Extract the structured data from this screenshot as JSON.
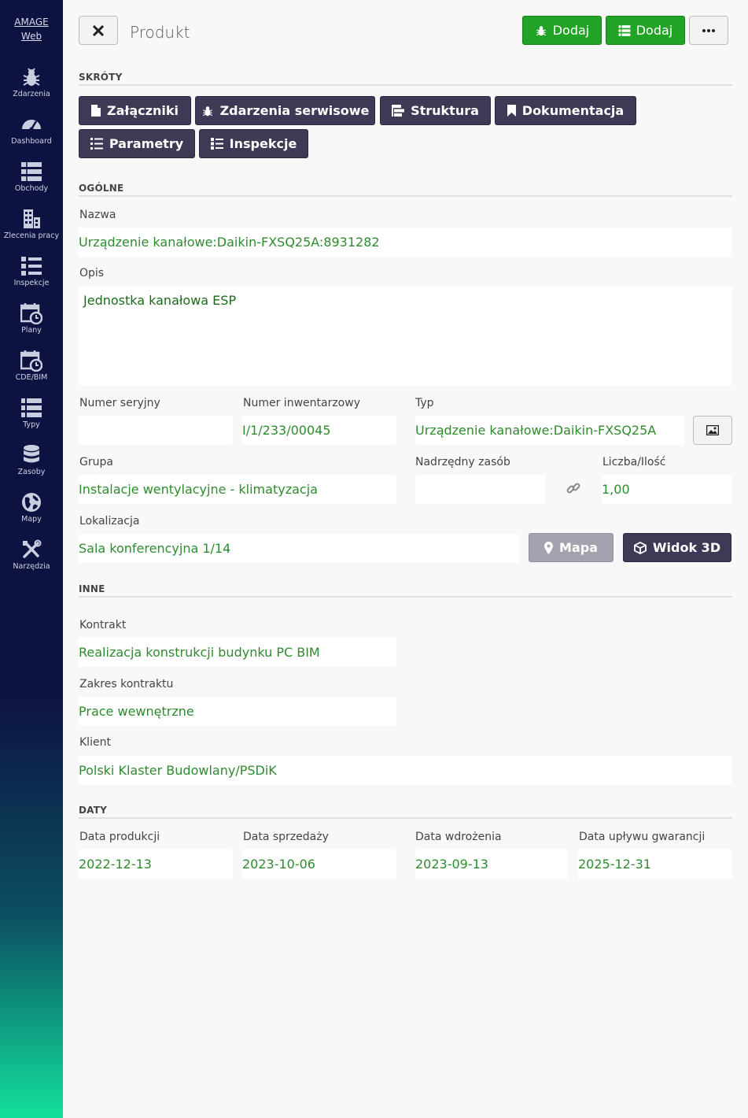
{
  "brand": {
    "line1": "AMAGE",
    "line2": "Web"
  },
  "sidebar": {
    "items": [
      {
        "label": "Zdarzenia",
        "icon": "bug-icon"
      },
      {
        "label": "Dashboard",
        "icon": "gauge-icon"
      },
      {
        "label": "Obchody",
        "icon": "list-icon"
      },
      {
        "label": "Zlecenia pracy",
        "icon": "building-icon"
      },
      {
        "label": "Inspekcje",
        "icon": "checklist-icon"
      },
      {
        "label": "Plany",
        "icon": "calendar-clock-icon"
      },
      {
        "label": "CDE/BIM",
        "icon": "calendar-clock-icon"
      },
      {
        "label": "Typy",
        "icon": "list-icon"
      },
      {
        "label": "Zasoby",
        "icon": "database-icon"
      },
      {
        "label": "Mapy",
        "icon": "globe-icon"
      },
      {
        "label": "Narzędzia",
        "icon": "tools-icon"
      }
    ]
  },
  "header": {
    "title": "Produkt",
    "add_event_label": "Dodaj",
    "add_list_label": "Dodaj"
  },
  "sections": {
    "shortcuts": "SKRÓTY",
    "general": "OGÓLNE",
    "other": "INNE",
    "dates": "DATY"
  },
  "shortcuts": [
    {
      "label": "Załączniki",
      "icon": "file-icon"
    },
    {
      "label": "Zdarzenia serwisowe",
      "icon": "bug-icon"
    },
    {
      "label": "Struktura",
      "icon": "tree-icon"
    },
    {
      "label": "Dokumentacja",
      "icon": "bookmark-icon"
    },
    {
      "label": "Parametry",
      "icon": "list-icon"
    },
    {
      "label": "Inspekcje",
      "icon": "checklist-icon"
    }
  ],
  "fields": {
    "name": {
      "label": "Nazwa",
      "value": "Urządzenie kanałowe:Daikin-FXSQ25A:8931282"
    },
    "description": {
      "label": "Opis",
      "value": "Jednostka kanałowa ESP"
    },
    "serial": {
      "label": "Numer seryjny",
      "value": ""
    },
    "inventory": {
      "label": "Numer inwentarzowy",
      "value": "I/1/233/00045"
    },
    "type": {
      "label": "Typ",
      "value": "Urządzenie kanałowe:Daikin-FXSQ25A"
    },
    "group": {
      "label": "Grupa",
      "value": "Instalacje wentylacyjne - klimatyzacja"
    },
    "parent": {
      "label": "Nadrzędny zasób",
      "value": ""
    },
    "quantity": {
      "label": "Liczba/Ilość",
      "value": "1,00"
    },
    "location": {
      "label": "Lokalizacja",
      "value": "Sala konferencyjna 1/14"
    },
    "contract": {
      "label": "Kontrakt",
      "value": "Realizacja konstrukcji budynku PC BIM"
    },
    "contract_scope": {
      "label": "Zakres kontraktu",
      "value": "Prace wewnętrzne"
    },
    "client": {
      "label": "Klient",
      "value": "Polski Klaster Budowlany/PSDiK"
    },
    "production_date": {
      "label": "Data produkcji",
      "value": "2022-12-13"
    },
    "sale_date": {
      "label": "Data sprzedaży",
      "value": "2023-10-06"
    },
    "deploy_date": {
      "label": "Data wdrożenia",
      "value": "2023-09-13"
    },
    "warranty_date": {
      "label": "Data upływu gwarancji",
      "value": "2025-12-31"
    }
  },
  "location_buttons": {
    "map": "Mapa",
    "view3d": "Widok 3D"
  }
}
